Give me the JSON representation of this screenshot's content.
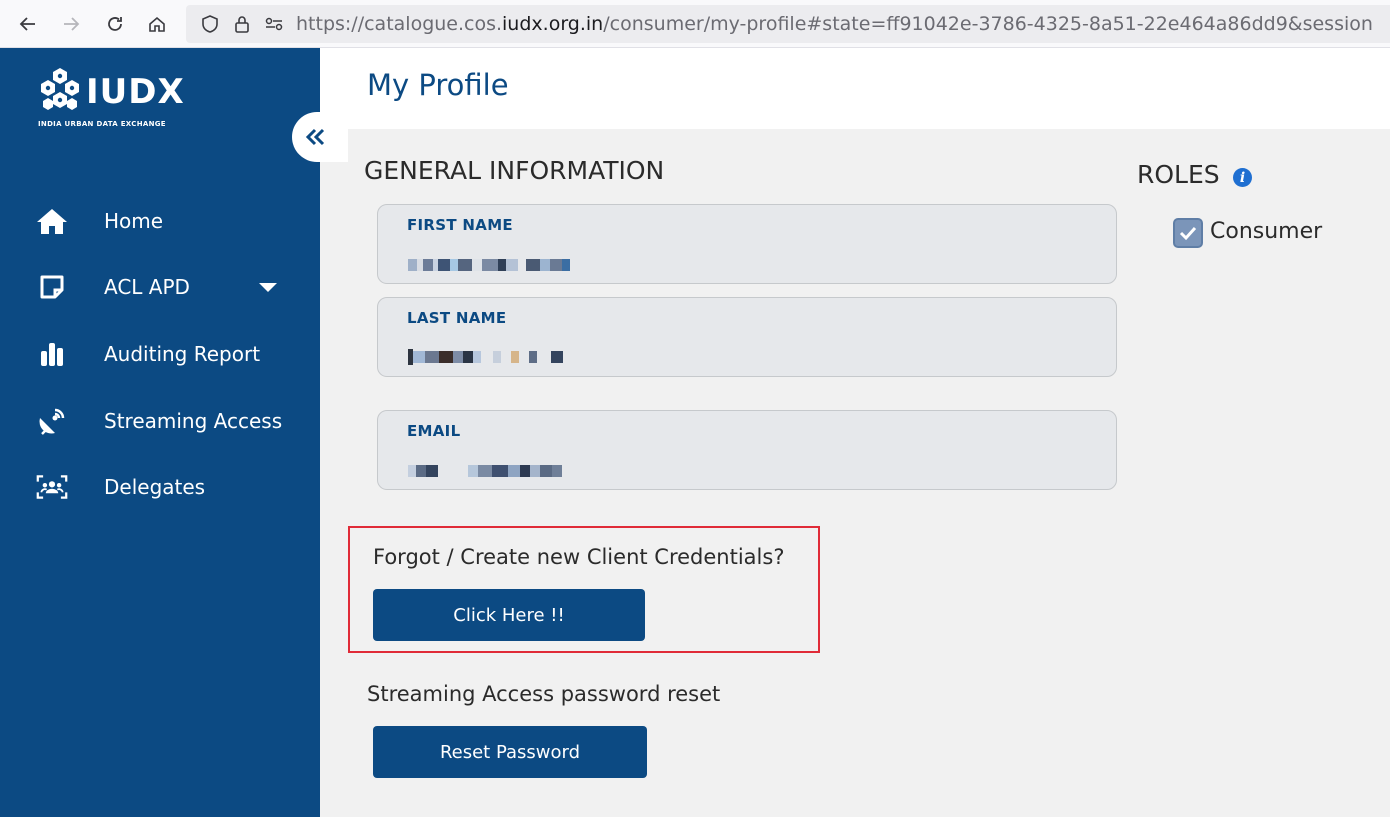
{
  "browser": {
    "url_prefix": "https://catalogue.cos.",
    "url_domain": "iudx.org.in",
    "url_suffix": "/consumer/my-profile#state=ff91042e-3786-4325-8a51-22e464a86dd9&session"
  },
  "sidebar": {
    "logo_title": "IUDX",
    "logo_subtitle": "INDIA URBAN DATA EXCHANGE",
    "items": [
      {
        "label": "Home",
        "icon": "home-icon"
      },
      {
        "label": "ACL APD",
        "icon": "note-icon"
      },
      {
        "label": "Auditing Report",
        "icon": "bar-chart-icon"
      },
      {
        "label": "Streaming Access",
        "icon": "satellite-dish-icon"
      },
      {
        "label": "Delegates",
        "icon": "group-icon"
      }
    ]
  },
  "header": {
    "title": "My Profile"
  },
  "general": {
    "title": "GENERAL INFORMATION",
    "first_name_label": "FIRST NAME",
    "last_name_label": "LAST NAME",
    "email_label": "EMAIL"
  },
  "roles": {
    "title": "ROLES",
    "items": [
      {
        "label": "Consumer",
        "checked": true
      }
    ]
  },
  "credentials": {
    "prompt": "Forgot / Create new Client Credentials?",
    "button": "Click Here !!"
  },
  "streaming": {
    "prompt": "Streaming Access password reset",
    "button": "Reset Password"
  },
  "colors": {
    "primary": "#0c4a83",
    "highlight": "#e02b38"
  }
}
